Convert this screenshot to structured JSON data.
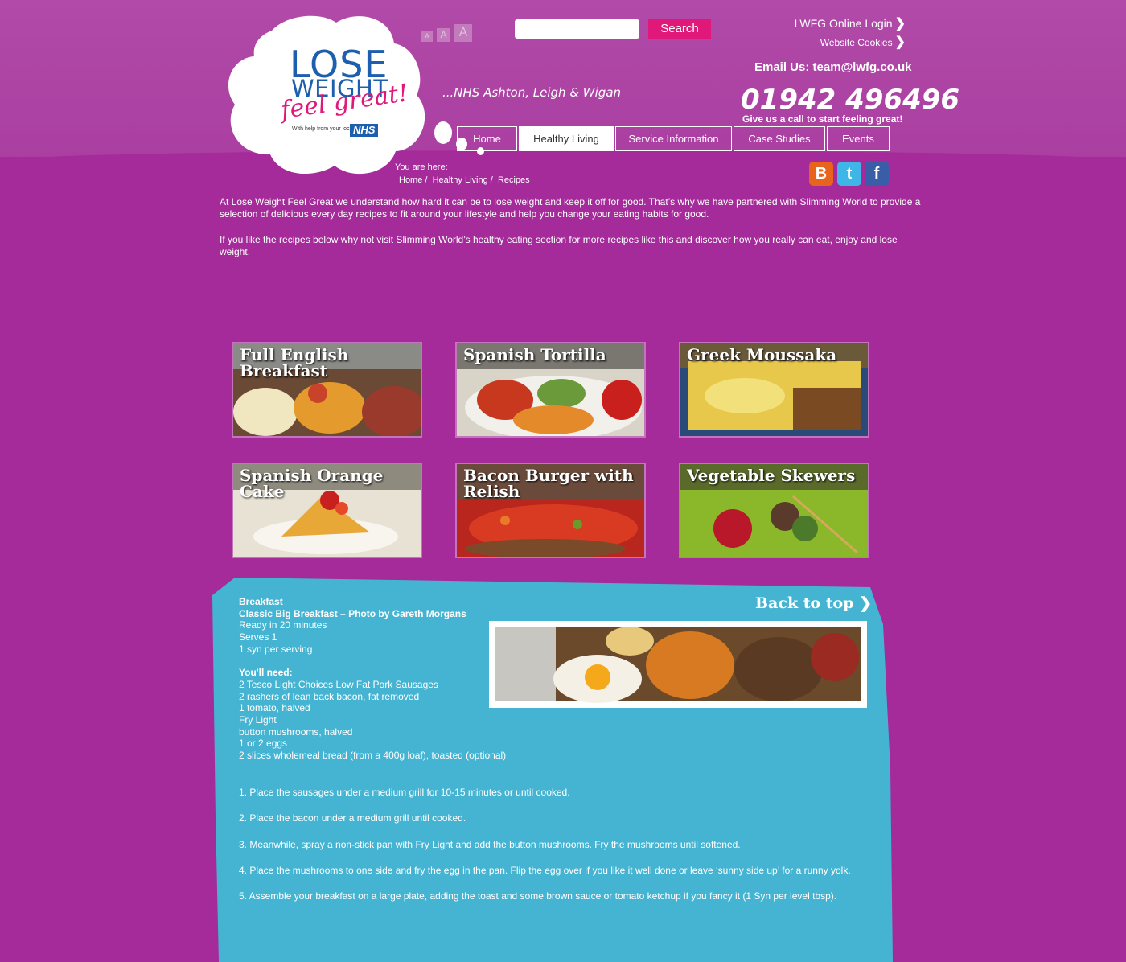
{
  "header": {
    "logo": {
      "lose": "LOSE",
      "weight": "WEIGHT",
      "feel_great": "feel great!",
      "small": "With help from your local",
      "nhs": "NHS"
    },
    "tagline": "...NHS Ashton, Leigh & Wigan",
    "font_sizes": [
      "A",
      "A",
      "A"
    ],
    "search": {
      "placeholder": "",
      "button_label": "Search"
    },
    "online_prefix": "LWFG Online",
    "login_label": "Login",
    "cookies_label": "Website Cookies",
    "email": "Email Us: team@lwfg.co.uk",
    "phone": "01942 496496",
    "phone_sub": "Give us a call to start feeling great!"
  },
  "nav": {
    "tabs": [
      {
        "label": "Home"
      },
      {
        "label": "Healthy Living"
      },
      {
        "label": "Service Information"
      },
      {
        "label": "Case Studies"
      },
      {
        "label": "Events"
      }
    ]
  },
  "breadcrumb": {
    "label": "You are here:",
    "items": [
      "Home",
      "Healthy Living",
      "Recipes"
    ],
    "separator": "/"
  },
  "social": {
    "blogger": "B",
    "twitter": "t",
    "facebook": "f"
  },
  "intro": {
    "p1": "At Lose Weight Feel Great we understand how hard it can be to lose weight and keep it off for good. That’s why we have partnered with Slimming World to provide a selection of delicious every day recipes to fit around your lifestyle and help you change your eating habits for good.",
    "p2_prefix": "If you like the recipes below why not visit Slimming World’s healthy eating section for more recipes like this and discover how you really",
    "p2_link": "can eat, enjoy and lose weight",
    "p2_suffix": "."
  },
  "recipes": [
    {
      "title": "Full English Breakfast"
    },
    {
      "title": "Spanish Tortilla"
    },
    {
      "title": "Greek Moussaka"
    },
    {
      "title": "Spanish Orange Cake"
    },
    {
      "title": "Bacon Burger with Relish"
    },
    {
      "title": "Vegetable Skewers"
    }
  ],
  "recipe_detail": {
    "category": "Breakfast",
    "title": "Classic Big Breakfast – Photo by Gareth Morgans",
    "ready": "Ready in 20 minutes",
    "serves": "Serves 1",
    "syn": "1 syn per serving",
    "need_heading": "You'll need:",
    "ingredients": [
      "2 Tesco Light Choices Low Fat Pork Sausages",
      "2 rashers of lean back bacon, fat removed",
      "1 tomato, halved",
      "Fry Light",
      "button mushrooms, halved",
      "1 or 2 eggs",
      "2 slices wholemeal bread (from a 400g loaf), toasted (optional)"
    ],
    "steps": [
      "1. Place the sausages under a medium grill for 10-15 minutes or until cooked.",
      "2. Place the bacon under a medium grill until cooked.",
      "3. Meanwhile, spray a non-stick pan with Fry Light and add the button mushrooms. Fry the mushrooms until softened.",
      "4. Place the mushrooms to one side and fry the egg in the pan. Flip the egg over if you like it well done or leave ‘sunny side up’ for a runny yolk.",
      "5. Assemble your breakfast on a large plate, adding the toast and some brown sauce or tomato ketchup if you fancy it (1 Syn per level tbsp)."
    ],
    "back_to_top": "Back to top"
  },
  "colors": {
    "background": "#a52a9a",
    "accent_pink": "#e0187a",
    "brand_blue": "#1d5fae",
    "panel_blue": "#45b4d2"
  }
}
